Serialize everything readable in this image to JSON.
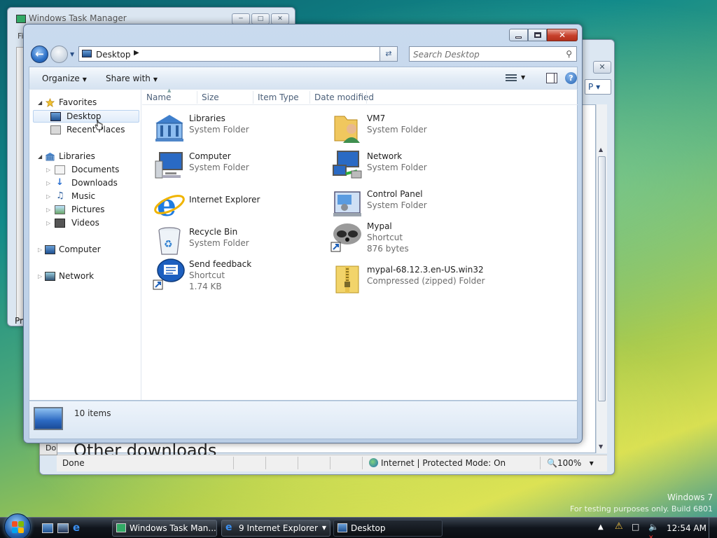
{
  "task_manager": {
    "title": "Windows Task Manager",
    "menu_stub": "Fi",
    "partial_label": "Pr"
  },
  "ie": {
    "search_stub": "P",
    "help_stub": "?",
    "page_text_partial": "Other downloads",
    "left_stub": "Do",
    "status": {
      "text": "Done",
      "zone": "Internet | Protected Mode: On",
      "zoom": "100%"
    }
  },
  "explorer": {
    "address": "Desktop",
    "search_placeholder": "Search Desktop",
    "toolbar": {
      "organize": "Organize",
      "share_with": "Share with"
    },
    "nav": {
      "favorites": "Favorites",
      "desktop": "Desktop",
      "recent_places": "Recent Places",
      "libraries": "Libraries",
      "documents": "Documents",
      "downloads": "Downloads",
      "music": "Music",
      "pictures": "Pictures",
      "videos": "Videos",
      "computer": "Computer",
      "network": "Network"
    },
    "columns": [
      "Name",
      "Size",
      "Item Type",
      "Date modified"
    ],
    "items": [
      {
        "name": "Libraries",
        "type": "System Folder",
        "size": "",
        "icon": "libraries-icon"
      },
      {
        "name": "VM7",
        "type": "System Folder",
        "size": "",
        "icon": "user-folder-icon"
      },
      {
        "name": "Computer",
        "type": "System Folder",
        "size": "",
        "icon": "computer-icon"
      },
      {
        "name": "Network",
        "type": "System Folder",
        "size": "",
        "icon": "network-icon"
      },
      {
        "name": "Internet Explorer",
        "type": "",
        "size": "",
        "icon": "internet-explorer-icon"
      },
      {
        "name": "Control Panel",
        "type": "System Folder",
        "size": "",
        "icon": "control-panel-icon"
      },
      {
        "name": "Recycle Bin",
        "type": "System Folder",
        "size": "",
        "icon": "recycle-bin-icon"
      },
      {
        "name": "Mypal",
        "type": "Shortcut",
        "size": "876 bytes",
        "icon": "mypal-shortcut-icon"
      },
      {
        "name": "Send feedback",
        "type": "Shortcut",
        "size": "1.74 KB",
        "icon": "send-feedback-shortcut-icon"
      },
      {
        "name": "mypal-68.12.3.en-US.win32",
        "type": "Compressed (zipped) Folder",
        "size": "",
        "icon": "zip-folder-icon"
      }
    ],
    "status_count": "10 items"
  },
  "watermark": {
    "line1": "Windows 7",
    "line2": "For testing purposes only. Build 6801"
  },
  "taskbar": {
    "buttons": {
      "task_manager": "Windows Task Man...",
      "internet_explorer": "9 Internet Explorer",
      "desktop": "Desktop"
    },
    "clock": "12:54 AM"
  },
  "colors": {
    "accent": "#2b6fc6",
    "close_red": "#c7402b",
    "taskbar": "#10151c"
  }
}
